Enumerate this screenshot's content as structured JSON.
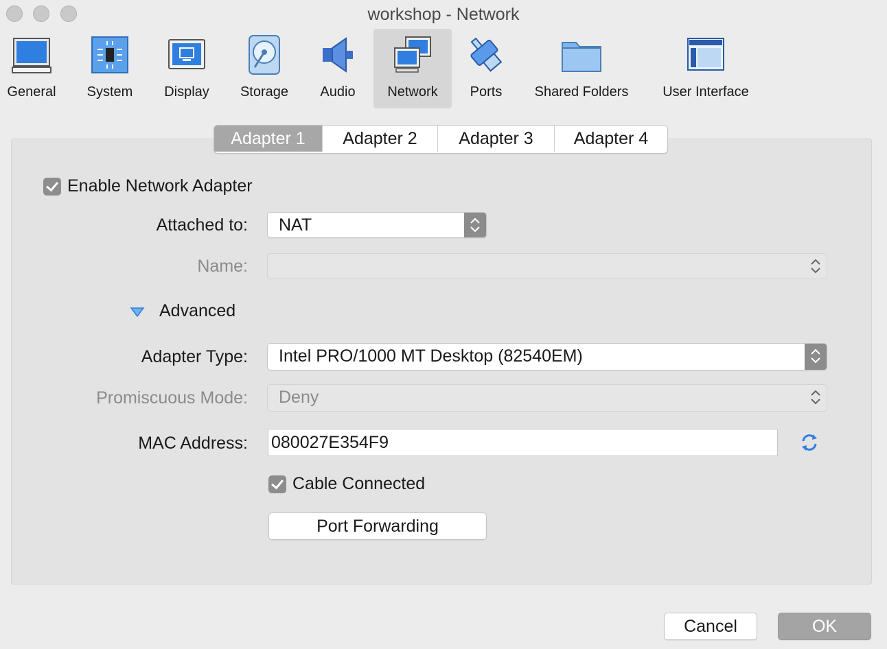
{
  "window": {
    "title": "workshop - Network"
  },
  "toolbar": {
    "items": [
      {
        "label": "General",
        "icon": "general-icon"
      },
      {
        "label": "System",
        "icon": "system-icon"
      },
      {
        "label": "Display",
        "icon": "display-icon"
      },
      {
        "label": "Storage",
        "icon": "storage-icon"
      },
      {
        "label": "Audio",
        "icon": "audio-icon"
      },
      {
        "label": "Network",
        "icon": "network-icon",
        "active": true
      },
      {
        "label": "Ports",
        "icon": "ports-icon"
      },
      {
        "label": "Shared Folders",
        "icon": "shared-folders-icon"
      },
      {
        "label": "User Interface",
        "icon": "user-interface-icon"
      }
    ]
  },
  "tabs": [
    {
      "label": "Adapter 1",
      "active": true
    },
    {
      "label": "Adapter 2"
    },
    {
      "label": "Adapter 3"
    },
    {
      "label": "Adapter 4"
    }
  ],
  "form": {
    "enable_adapter": {
      "label": "Enable Network Adapter",
      "checked": true
    },
    "attached_to": {
      "label": "Attached to:",
      "value": "NAT"
    },
    "name": {
      "label": "Name:",
      "value": "",
      "disabled": true
    },
    "advanced": {
      "label": "Advanced",
      "expanded": true
    },
    "adapter_type": {
      "label": "Adapter Type:",
      "value": "Intel PRO/1000 MT Desktop (82540EM)"
    },
    "promiscuous_mode": {
      "label": "Promiscuous Mode:",
      "value": "Deny",
      "disabled": true
    },
    "mac_address": {
      "label": "MAC Address:",
      "value": "080027E354F9"
    },
    "cable_connected": {
      "label": "Cable Connected",
      "checked": true
    },
    "port_forwarding": {
      "label": "Port Forwarding"
    }
  },
  "footer": {
    "cancel_label": "Cancel",
    "ok_label": "OK"
  },
  "colors": {
    "accent_blue": "#3b82d6",
    "active_tab": "#a7a7a7",
    "panel": "#e3e3e3"
  }
}
